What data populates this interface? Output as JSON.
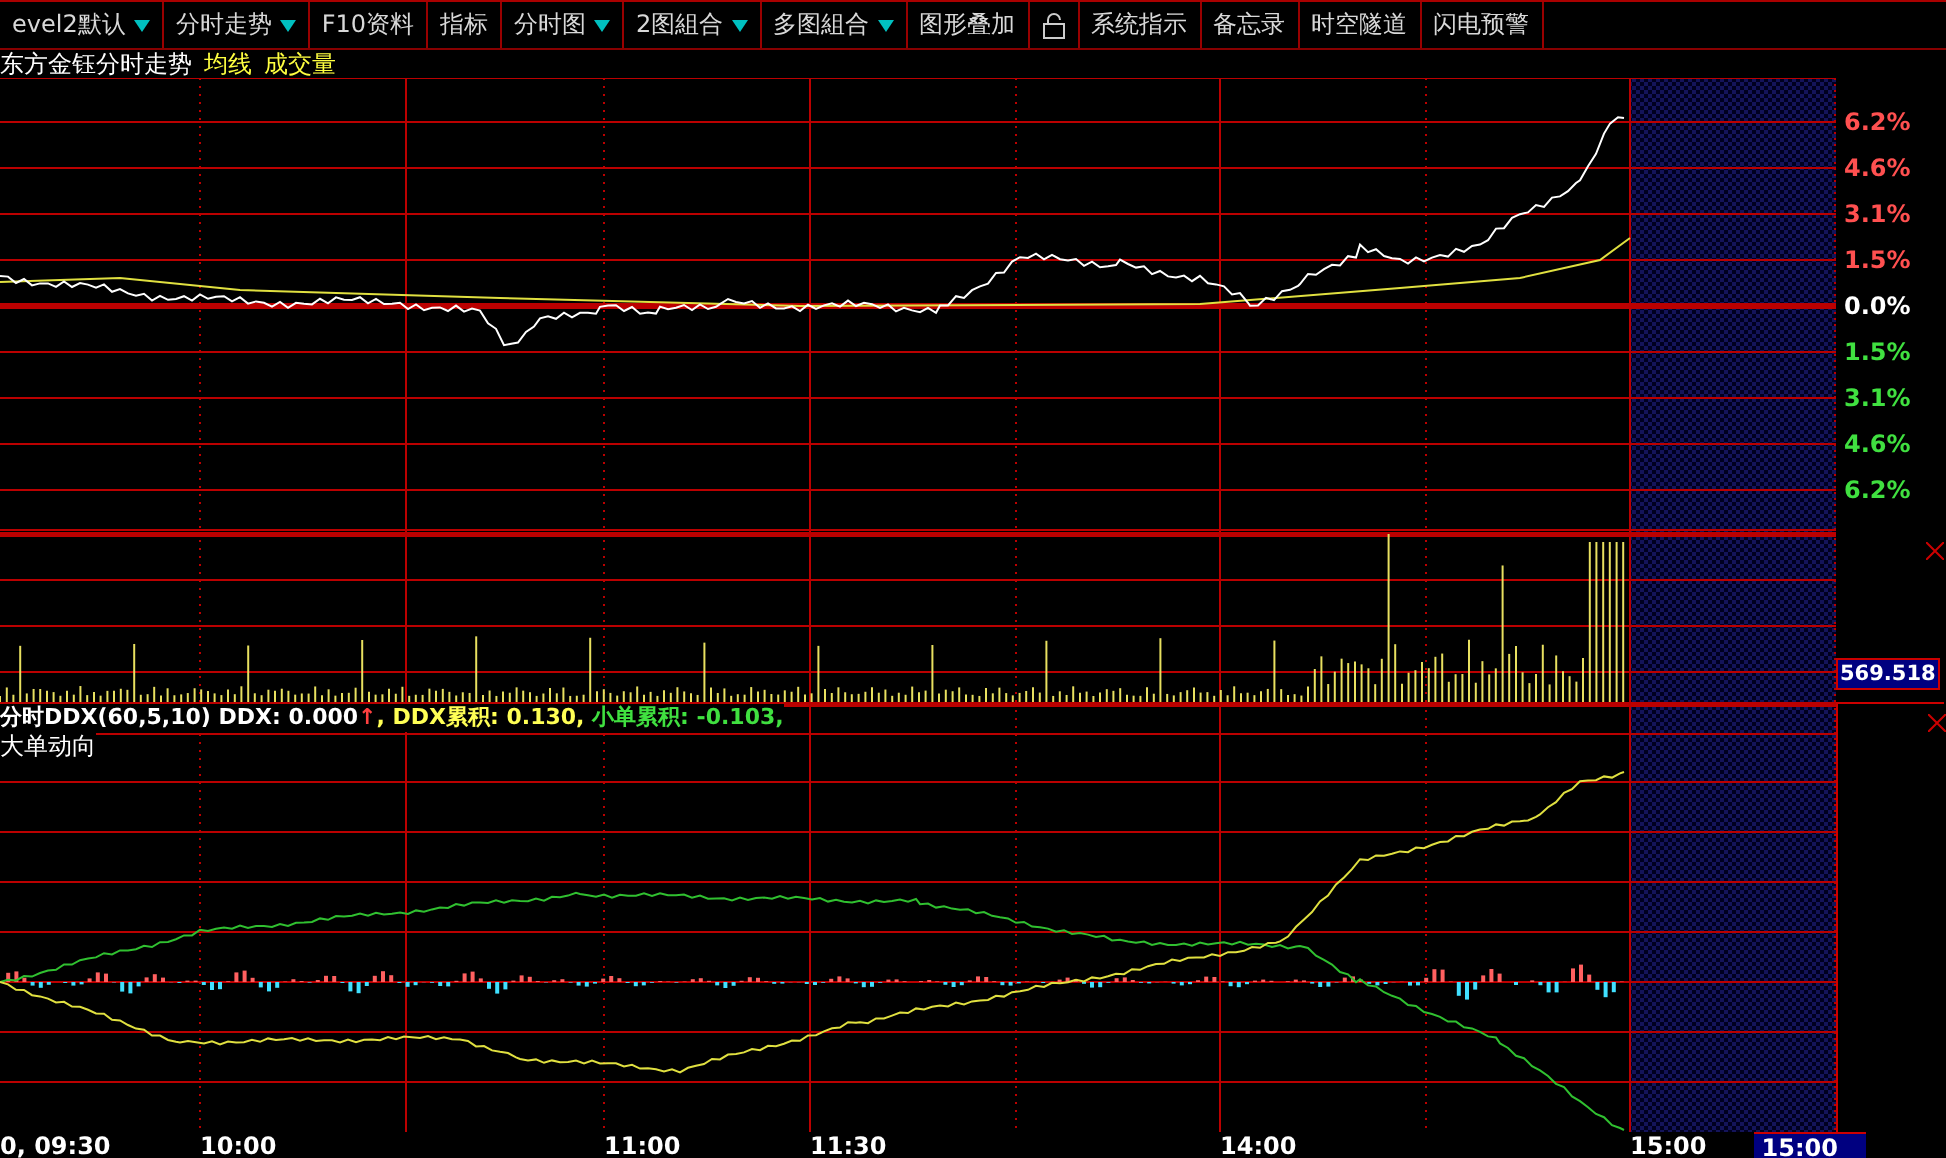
{
  "toolbar": [
    {
      "label": "evel2默认",
      "has_menu": true
    },
    {
      "label": "分时走势",
      "has_menu": true
    },
    {
      "label": "F10资料",
      "has_menu": false
    },
    {
      "label": "指标",
      "has_menu": false
    },
    {
      "label": "分时图",
      "has_menu": true
    },
    {
      "label": "2图組合",
      "has_menu": true
    },
    {
      "label": "多图組合",
      "has_menu": true
    },
    {
      "label": "图形叠加",
      "has_menu": false
    },
    {
      "kind": "lock"
    },
    {
      "label": "系统指示",
      "has_menu": false
    },
    {
      "label": "备忘录",
      "has_menu": false
    },
    {
      "label": "时空隧道",
      "has_menu": false
    },
    {
      "label": "闪电预警",
      "has_menu": false
    }
  ],
  "legend": [
    {
      "text": "东方金钰分时走势",
      "color": "#ffffff"
    },
    {
      "text": "均线",
      "color": "#ffff40"
    },
    {
      "text": "成交量",
      "color": "#ffff40"
    }
  ],
  "price_axis": [
    {
      "label": "6.2%",
      "color": "#ff5050"
    },
    {
      "label": "4.6%",
      "color": "#ff5050"
    },
    {
      "label": "3.1%",
      "color": "#ff5050"
    },
    {
      "label": "1.5%",
      "color": "#ff5050"
    },
    {
      "label": "0.0%",
      "color": "#ffffff"
    },
    {
      "label": "1.5%",
      "color": "#40e040"
    },
    {
      "label": "3.1%",
      "color": "#40e040"
    },
    {
      "label": "4.6%",
      "color": "#40e040"
    },
    {
      "label": "6.2%",
      "color": "#40e040"
    }
  ],
  "volume_axis": {
    "value": "569.518"
  },
  "indicator": {
    "parts": [
      {
        "text": "分时DDX(60,5,10)",
        "color": "#ffffff"
      },
      {
        "text": " DDX: 0.000",
        "color": "#ffffff"
      },
      {
        "text": "↑",
        "color": "#ff4040"
      },
      {
        "text": ", DDX累积: 0.130,",
        "color": "#ffff55"
      },
      {
        "text": " 小单累积: -0.103,",
        "color": "#40e040"
      }
    ],
    "subtitle": "大单动向"
  },
  "time_axis": [
    "0, 09:30",
    "10:00",
    "11:00",
    "11:30",
    "14:00",
    "15:00"
  ],
  "cursor_time": "15:00"
}
